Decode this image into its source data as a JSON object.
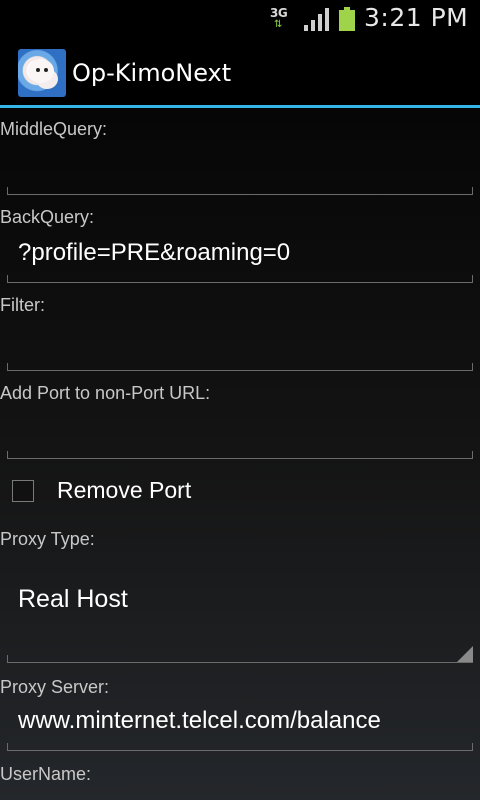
{
  "status_bar": {
    "network_type": "3G",
    "network_arrows": "⇅",
    "signal_icon": "signal-bars-icon",
    "battery_icon": "battery-icon",
    "time": "3:21 PM"
  },
  "app_bar": {
    "title": "Op-KimoNext",
    "icon": "app-icon",
    "accent_color": "#33b5e5"
  },
  "form": {
    "middle_query": {
      "label": "MiddleQuery:",
      "value": ""
    },
    "back_query": {
      "label": "BackQuery:",
      "value": "?profile=PRE&roaming=0"
    },
    "filter": {
      "label": "Filter:",
      "value": ""
    },
    "add_port": {
      "label": "Add Port to non-Port URL:",
      "value": ""
    },
    "remove_port": {
      "label": "Remove Port",
      "checked": false
    },
    "proxy_type": {
      "label": "Proxy Type:",
      "selected": "Real Host"
    },
    "proxy_server": {
      "label": "Proxy Server:",
      "value": "www.minternet.telcel.com/balance"
    },
    "username": {
      "label": "UserName:"
    }
  }
}
